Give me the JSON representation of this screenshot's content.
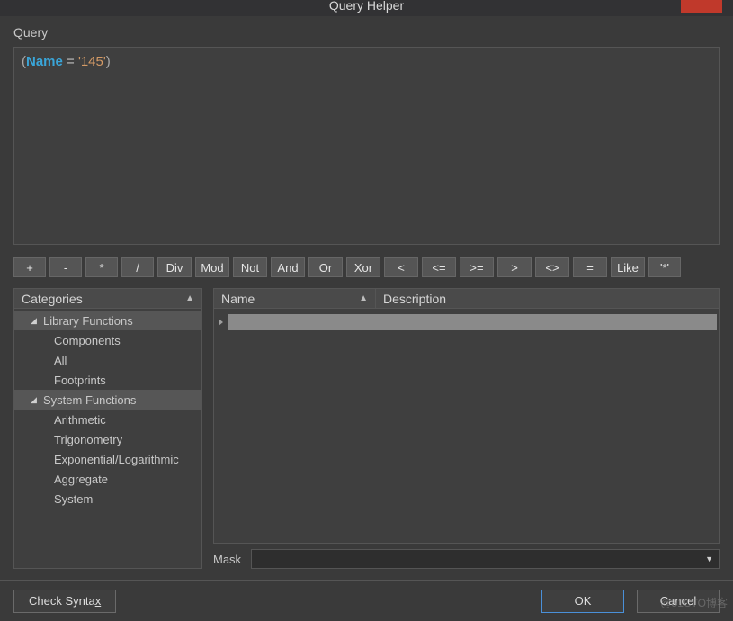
{
  "window": {
    "title": "Query Helper"
  },
  "labels": {
    "query": "Query",
    "categories": "Categories",
    "name": "Name",
    "description": "Description",
    "mask": "Mask"
  },
  "query_tokens": {
    "open": "(",
    "ident": "Name",
    "eq": " = ",
    "str": "'145'",
    "close": ")"
  },
  "operators": [
    "+",
    "-",
    "*",
    "/",
    "Div",
    "Mod",
    "Not",
    "And",
    "Or",
    "Xor",
    "<",
    "<=",
    ">=",
    ">",
    "<>",
    "=",
    "Like",
    "'*'"
  ],
  "categories": [
    {
      "label": "Library Functions",
      "expanded": true,
      "children": [
        {
          "label": "Components"
        },
        {
          "label": "All"
        },
        {
          "label": "Footprints"
        }
      ]
    },
    {
      "label": "System Functions",
      "expanded": true,
      "children": [
        {
          "label": "Arithmetic"
        },
        {
          "label": "Trigonometry"
        },
        {
          "label": "Exponential/Logarithmic"
        },
        {
          "label": "Aggregate"
        },
        {
          "label": "System"
        }
      ]
    }
  ],
  "mask": {
    "value": ""
  },
  "buttons": {
    "check_syntax_pre": "Check Synta",
    "check_syntax_x": "x",
    "ok": "OK",
    "cancel": "Cancel"
  },
  "watermark": "@51CTO博客"
}
